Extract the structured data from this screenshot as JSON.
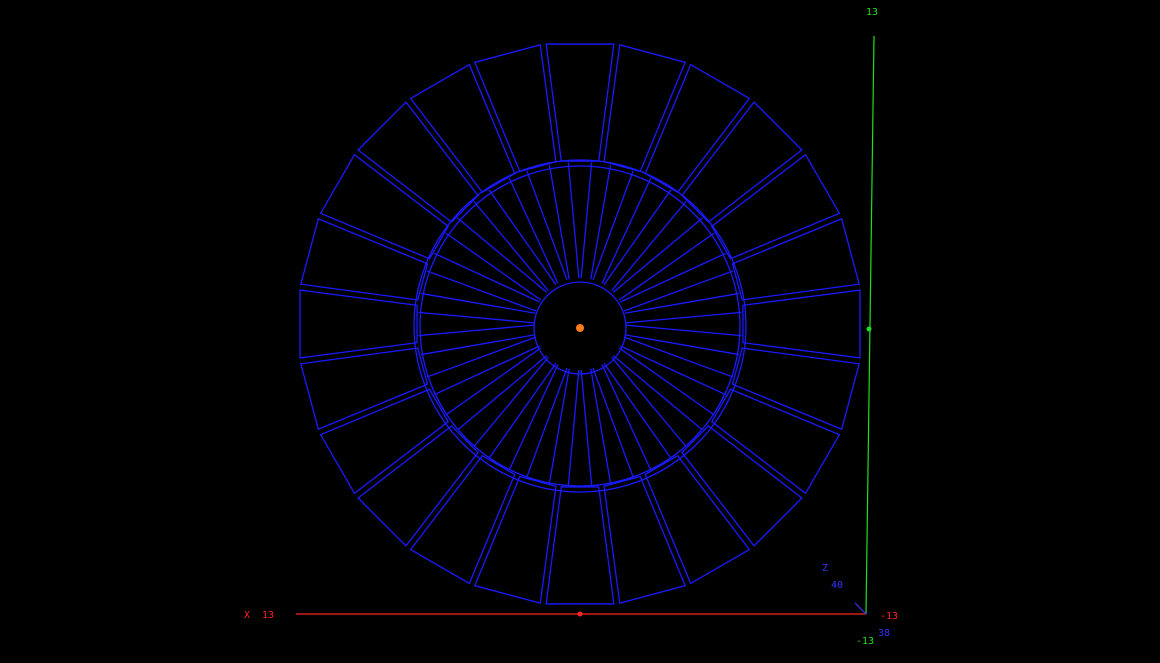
{
  "scene": {
    "background": "#000000",
    "wireframe_color": "#1a1aff",
    "center_marker_color": "#ff7a1a",
    "inner_hub_segments": 24,
    "outer_ring_segments": 24
  },
  "axes": {
    "x": {
      "name": "X",
      "max_label": "13",
      "min_label": "-13",
      "color": "#ff2222"
    },
    "y": {
      "top_label": "13",
      "bottom_label": "-13",
      "color": "#22dd22"
    },
    "z": {
      "name": "Z",
      "value_label": "40",
      "corner_label": "38",
      "color": "#3333ff"
    }
  }
}
